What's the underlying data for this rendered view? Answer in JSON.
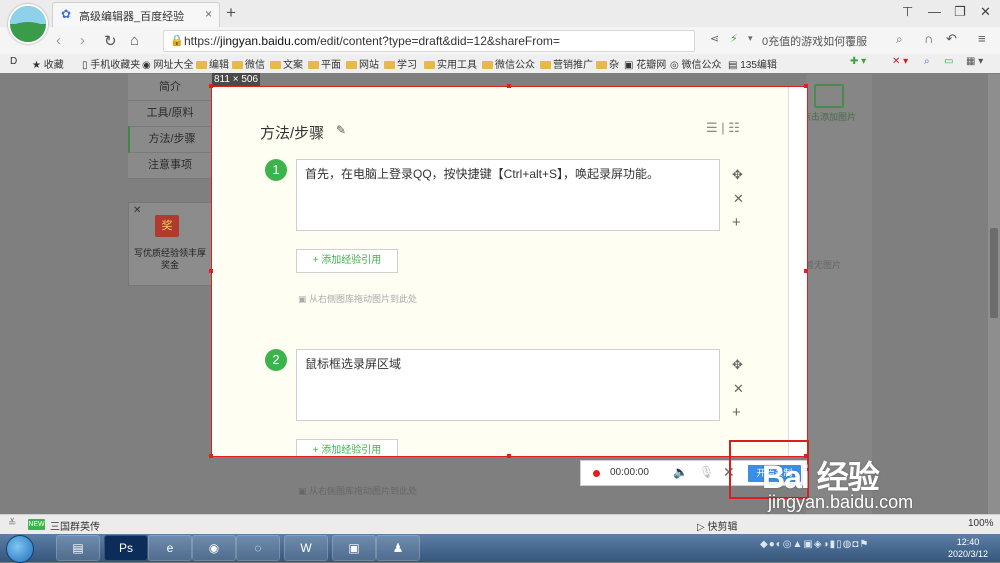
{
  "browser": {
    "tab_title": "高级编辑器_百度经验",
    "tab_close": "×",
    "new_tab": "+",
    "url_prefix": "https://",
    "url_domain": "jingyan.baidu.com",
    "url_path": "/edit/content?type=draft&did=12&shareFrom=",
    "search_hint": "0充值的游戏如何覆服",
    "nav": {
      "back": "‹",
      "forward": "›",
      "reload": "↻",
      "home": "⌂"
    },
    "window_buttons": [
      "⊤",
      "—",
      "❐",
      "✕"
    ]
  },
  "bookmarks": {
    "toggle": "D",
    "items": [
      "收藏",
      "手机收藏夹",
      "网址大全",
      "编辑",
      "微信",
      "文案",
      "平面",
      "网站",
      "学习",
      "实用工具",
      "微信公众",
      "营销推广",
      "杂",
      "花瓣网",
      "微信公众",
      "135编辑"
    ]
  },
  "page": {
    "left_nav": [
      "简介",
      "工具/原料",
      "方法/步骤",
      "注意事项"
    ],
    "promo": {
      "close": "✕",
      "icon_text": "奖",
      "text": "写优质经验领丰厚奖金"
    },
    "right_add_image": "点击添加图片",
    "right_no_image": "您暂无图片"
  },
  "capture": {
    "size_label": "811 × 506",
    "section_title": "方法/步骤",
    "steps": [
      {
        "number": "1",
        "text": "首先，在电脑上登录QQ，按快捷键【Ctrl+alt+S】，唤起录屏功能。"
      },
      {
        "number": "2",
        "text": "鼠标框选录屏区域"
      }
    ],
    "add_reference": "+ 添加经验引用",
    "drag_hint": "从右侧图库拖动图片到此处"
  },
  "recorder": {
    "time": "00:00:00",
    "start_label": "开始录制"
  },
  "statusbar": {
    "new_badge": "NEW",
    "left_text": "三国群英传",
    "right_text": "快剪辑",
    "zoom": "100%"
  },
  "taskbar": {
    "clock_time": "12:40",
    "clock_date": "2020/3/12"
  },
  "watermark": {
    "logo": "Bai 经验",
    "url": "jingyan.baidu.com"
  }
}
